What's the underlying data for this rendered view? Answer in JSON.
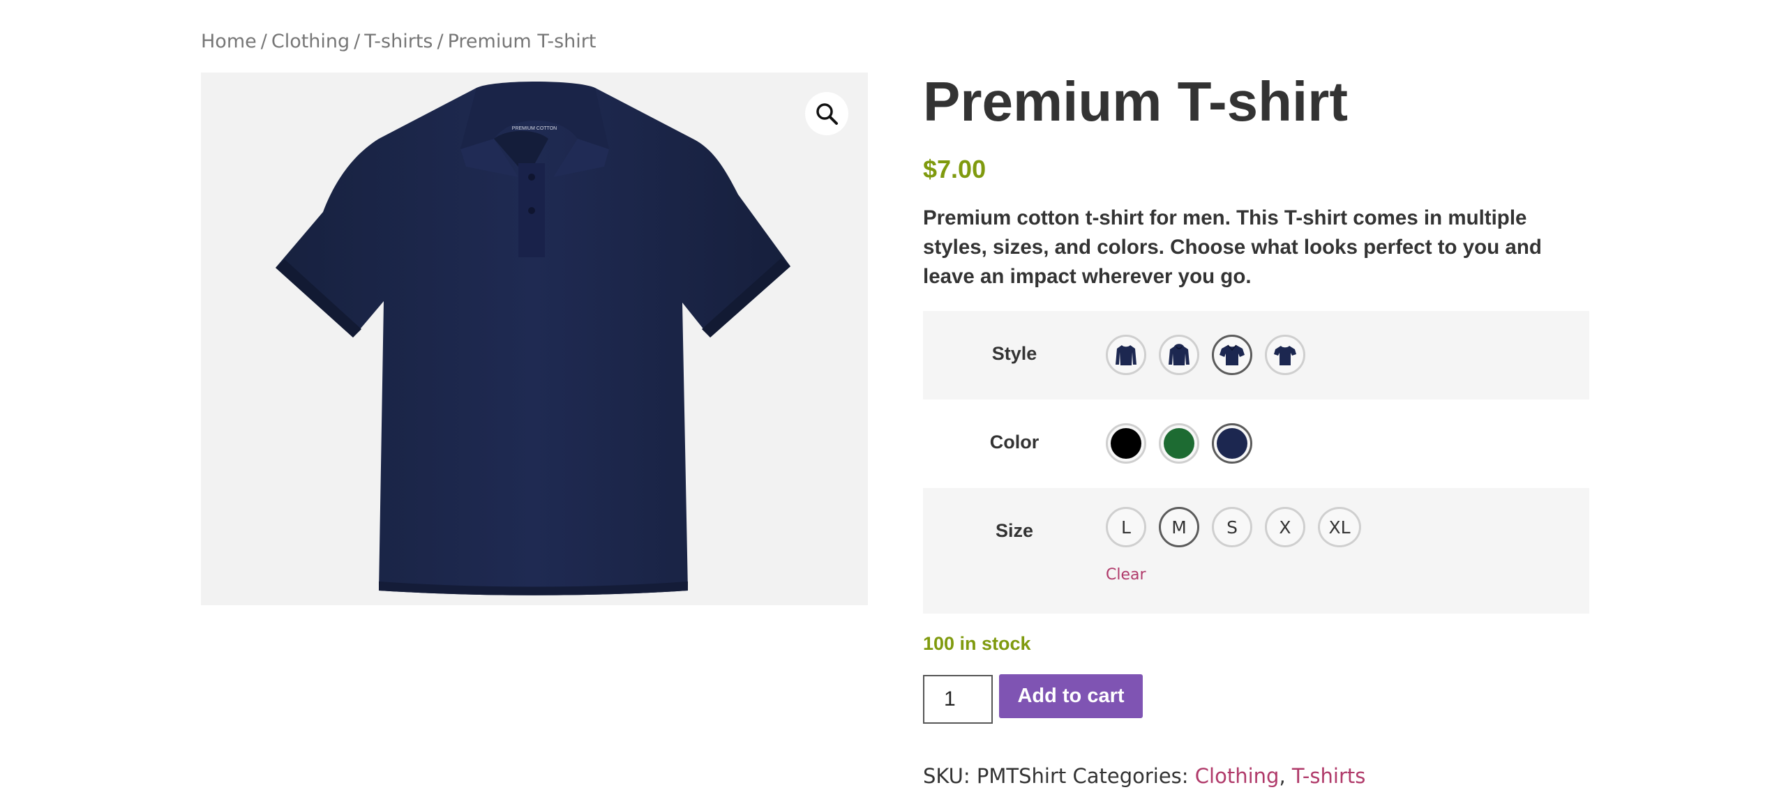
{
  "breadcrumb": {
    "items": [
      "Home",
      "Clothing",
      "T-shirts"
    ],
    "current": "Premium T-shirt",
    "separator": "/"
  },
  "gallery": {
    "image_alt": "Navy polo t-shirt",
    "label_text": "PREMIUM COTTON",
    "zoom_icon": "search-icon"
  },
  "product": {
    "title": "Premium T-shirt",
    "price": "$7.00",
    "description": "Premium cotton t-shirt for men. This T-shirt comes in multiple styles, sizes, and colors. Choose what looks perfect to you and leave an impact wherever you go."
  },
  "variations": {
    "style": {
      "label": "Style",
      "options": [
        "long-sleeve-icon",
        "hoodie-icon",
        "polo-icon",
        "t-shirt-icon"
      ],
      "selected": 2
    },
    "color": {
      "label": "Color",
      "options": [
        {
          "name": "black",
          "hex": "#000000"
        },
        {
          "name": "green",
          "hex": "#1d6b32"
        },
        {
          "name": "navy",
          "hex": "#1c2750"
        }
      ],
      "selected": 2
    },
    "size": {
      "label": "Size",
      "options": [
        "L",
        "M",
        "S",
        "X",
        "XL"
      ],
      "selected": 1
    },
    "clear_label": "Clear"
  },
  "stock": "100 in stock",
  "cart": {
    "quantity": "1",
    "button_label": "Add to cart"
  },
  "meta": {
    "sku_label": "SKU:",
    "sku": "PMTShirt",
    "categories_label": "Categories:",
    "categories": [
      "Clothing",
      "T-shirts"
    ]
  },
  "colors": {
    "accent_purple": "#7f54b3",
    "price_green": "#7f9a0e",
    "link_pink": "#b03a6a",
    "shirt_navy": "#1c2750"
  }
}
